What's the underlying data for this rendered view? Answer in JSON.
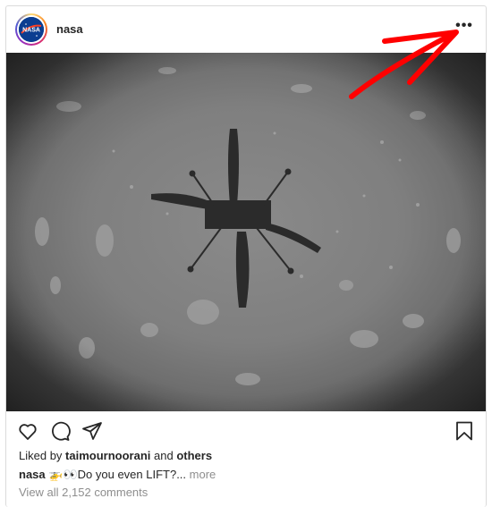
{
  "post": {
    "username": "nasa",
    "avatar_text": "NASA",
    "more_icon": "•••",
    "liked_by_prefix": "Liked by",
    "liked_by_user": "taimournoorani",
    "liked_by_and": "and",
    "liked_by_others": "others",
    "caption_user": "nasa",
    "caption_emoji": "🚁👀",
    "caption_text": "Do you even LIFT?...",
    "caption_more": "more",
    "view_comments": "View all 2,152 comments"
  },
  "icons": {
    "like": "heart-icon",
    "comment": "comment-icon",
    "share": "paper-plane-icon",
    "save": "bookmark-icon",
    "more": "ellipsis-icon"
  },
  "colors": {
    "annotation_arrow": "#ff0000",
    "text": "#262626",
    "muted": "#8e8e8e",
    "border": "#dbdbdb"
  }
}
